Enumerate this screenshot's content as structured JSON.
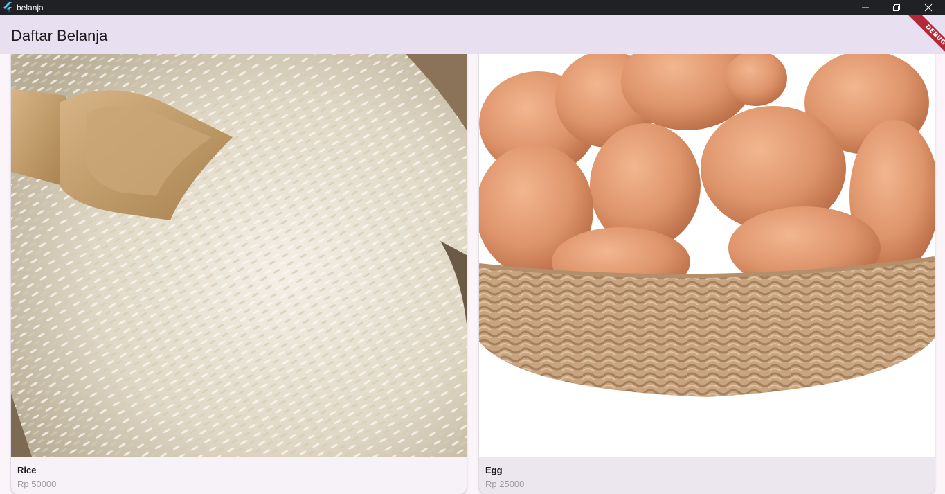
{
  "window": {
    "title": "belanja",
    "app_icon": "flutter-icon",
    "controls": [
      "minimize-icon",
      "maximize-icon",
      "close-icon"
    ]
  },
  "appbar": {
    "title": "Daftar Belanja",
    "debug_banner": "DEBUG"
  },
  "products": [
    {
      "name": "Rice",
      "price": "Rp 50000",
      "image": "rice-photo"
    },
    {
      "name": "Egg",
      "price": "Rp 25000",
      "image": "eggs-in-basket-photo"
    }
  ],
  "colors": {
    "titlebar": "#1f2124",
    "appbar": "#e8e0f0",
    "background": "#fbf5fa",
    "debug_banner": "#b4283a"
  }
}
